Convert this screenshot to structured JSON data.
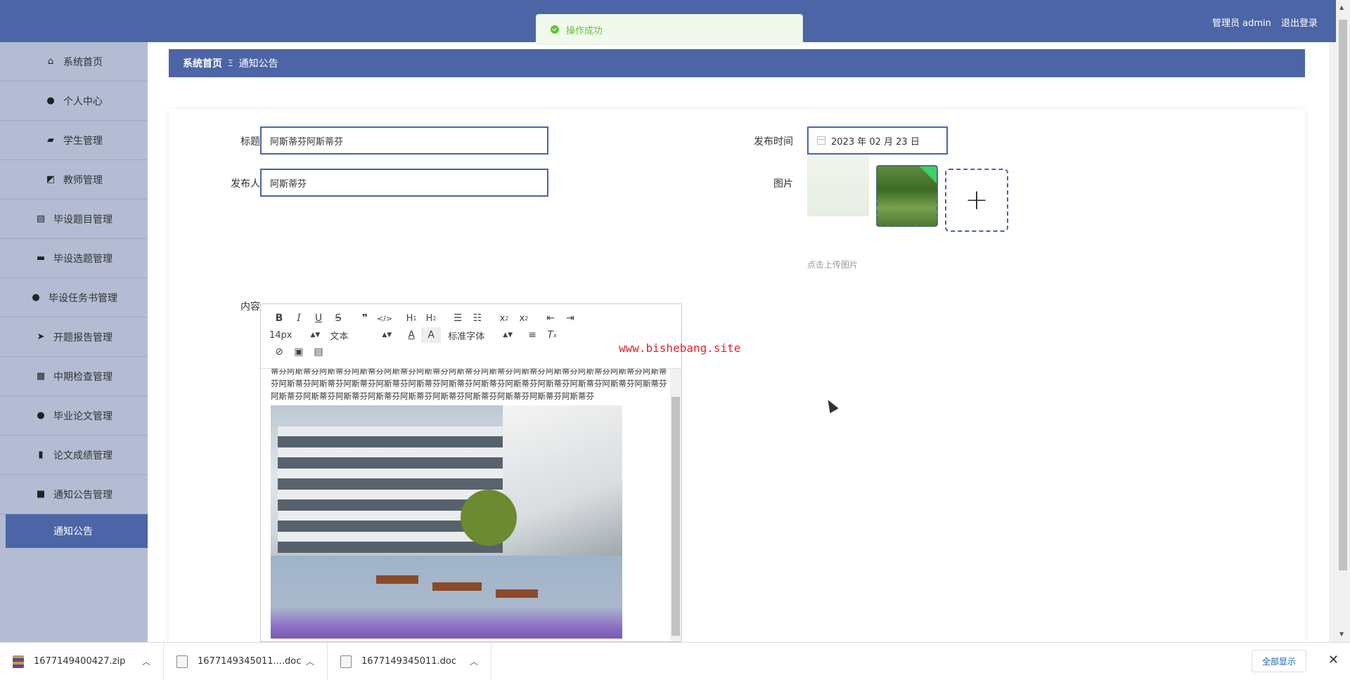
{
  "header": {
    "user_role": "管理员 admin",
    "logout": "退出登录"
  },
  "toast": {
    "message": "操作成功",
    "color": "#67c23a"
  },
  "sidebar": {
    "items": [
      {
        "label": "系统首页",
        "icon": "home-icon"
      },
      {
        "label": "个人中心",
        "icon": "user-icon"
      },
      {
        "label": "学生管理",
        "icon": "student-icon"
      },
      {
        "label": "教师管理",
        "icon": "chart-icon"
      },
      {
        "label": "毕设题目管理",
        "icon": "clipboard-icon"
      },
      {
        "label": "毕设选题管理",
        "icon": "briefcase-icon"
      },
      {
        "label": "毕设任务书管理",
        "icon": "user-tie-icon"
      },
      {
        "label": "开题报告管理",
        "icon": "paper-plane-icon"
      },
      {
        "label": "中期检查管理",
        "icon": "grid-icon"
      },
      {
        "label": "毕业论文管理",
        "icon": "user-icon"
      },
      {
        "label": "论文成绩管理",
        "icon": "book-icon"
      },
      {
        "label": "通知公告管理",
        "icon": "video-icon"
      }
    ],
    "active_sub": "通知公告"
  },
  "breadcrumb": {
    "home": "系统首页",
    "separator": "Ξ",
    "current": "通知公告"
  },
  "form": {
    "title_label": "标题",
    "title_value": "阿斯蒂芬阿斯蒂芬",
    "publisher_label": "发布人",
    "publisher_value": "阿斯蒂芬",
    "time_label": "发布时间",
    "time_value": "2023 年 02 月 23 日",
    "image_label": "图片",
    "upload_tip": "点击上传图片",
    "content_label": "内容"
  },
  "editor": {
    "font_size": "14px",
    "block_type": "文本",
    "font_family": "标准字体",
    "body_text": "蒂芬阿斯蒂芬阿斯蒂芬阿斯蒂芬阿斯蒂芬阿斯蒂芬阿斯蒂芬阿斯蒂芬阿斯蒂芬阿斯蒂芬阿斯蒂芬阿斯蒂芬阿斯蒂芬阿斯蒂芬阿斯蒂芬阿斯蒂芬阿斯蒂芬阿斯蒂芬阿斯蒂芬阿斯蒂芬阿斯蒂芬阿斯蒂芬阿斯蒂芬阿斯蒂芬阿斯蒂芬阿斯蒂芬阿斯蒂芬阿斯蒂芬阿斯蒂芬阿斯蒂芬阿斯蒂芬阿斯蒂芬阿斯蒂芬阿斯蒂芬阿斯蒂芬"
  },
  "watermark": "www.bishebang.site",
  "downloads": {
    "items": [
      {
        "name": "1677149400427.zip",
        "type": "zip"
      },
      {
        "name": "1677149345011....doc",
        "type": "doc"
      },
      {
        "name": "1677149345011.doc",
        "type": "doc"
      }
    ],
    "show_all": "全部显示"
  },
  "colors": {
    "primary": "#4b65a6",
    "sidebar": "#b3bcd3",
    "watermark": "#e0242a"
  }
}
